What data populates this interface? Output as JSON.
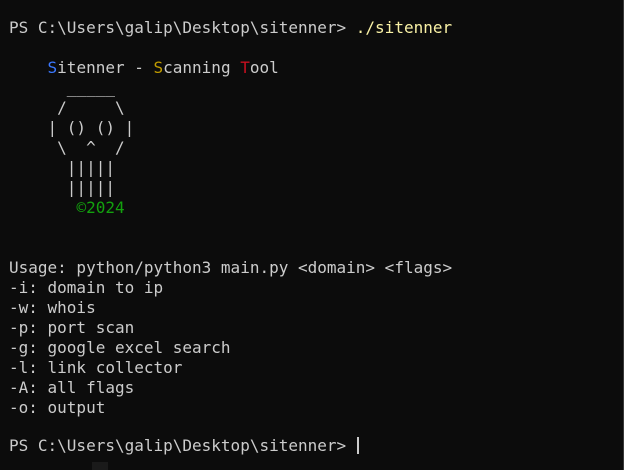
{
  "terminal": {
    "prompt1": "PS C:\\Users\\galip\\Desktop\\sitenner> ",
    "command": "./sitenner",
    "banner": {
      "s1": "S",
      "p1": "itenner - ",
      "s2": "S",
      "p2": "canning ",
      "s3": "T",
      "p3": "ool"
    },
    "art": [
      "      _____",
      "     /     \\",
      "    | () () |",
      "     \\  ^  /",
      "      |||||",
      "      |||||"
    ],
    "art_indent": "       ",
    "year": "©2024",
    "usage": "Usage: python/python3 main.py <domain> <flags>",
    "flags": [
      "-i: domain to ip",
      "-w: whois",
      "-p: port scan",
      "-g: google excel search",
      "-l: link collector",
      "-A: all flags",
      "-o: output"
    ],
    "prompt2": "PS C:\\Users\\galip\\Desktop\\sitenner> "
  },
  "colors": {
    "background": "#0c0c0c",
    "text": "#cccccc",
    "command": "#f9f1a5",
    "banner_s1": "#3b78ff",
    "banner_s2": "#c19c00",
    "banner_t": "#c50f1f",
    "year": "#13a10e"
  }
}
